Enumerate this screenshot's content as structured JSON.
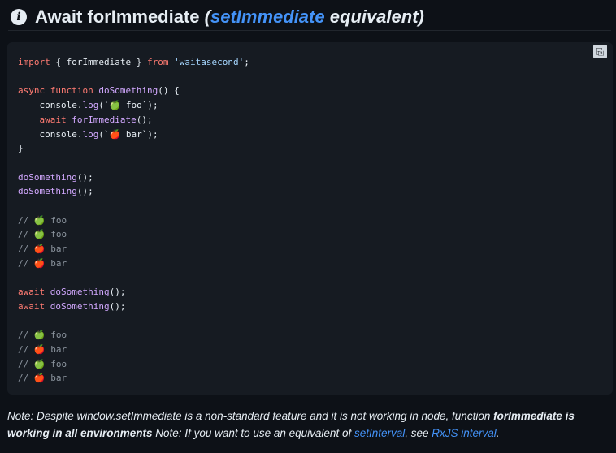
{
  "heading": {
    "anchor_glyph": "i",
    "title_main": "Await forImmediate ",
    "paren_open": "(",
    "link_text": "setImmediate",
    "paren_rest": " equivalent)"
  },
  "code": {
    "copy_icon": "copy-icon",
    "lines": {
      "l1": {
        "kw1": "import",
        "p1": " { forImmediate } ",
        "kw2": "from",
        "sp": " ",
        "str": "'waitasecond'",
        "end": ";"
      },
      "l3": {
        "kw1": "async",
        "sp1": " ",
        "kw2": "function",
        "sp2": " ",
        "fn": "doSomething",
        "end": "() {"
      },
      "l4": {
        "indent": "    console.",
        "fn": "log",
        "open": "(`",
        "icon": "🍏",
        "text": " foo`);"
      },
      "l5": {
        "indent": "    ",
        "kw": "await",
        "sp": " ",
        "fn": "forImmediate",
        "end": "();"
      },
      "l6": {
        "indent": "    console.",
        "fn": "log",
        "open": "(`",
        "icon": "🍎",
        "text": " bar`);"
      },
      "l7": {
        "text": "}"
      },
      "l9": {
        "fn": "doSomething",
        "end": "();"
      },
      "l10": {
        "fn": "doSomething",
        "end": "();"
      },
      "c1": {
        "slash": "// ",
        "icon": "🍏",
        "text": " foo"
      },
      "c2": {
        "slash": "// ",
        "icon": "🍏",
        "text": " foo"
      },
      "c3": {
        "slash": "// ",
        "icon": "🍎",
        "text": " bar"
      },
      "c4": {
        "slash": "// ",
        "icon": "🍎",
        "text": " bar"
      },
      "l17": {
        "kw": "await",
        "sp": " ",
        "fn": "doSomething",
        "end": "();"
      },
      "l18": {
        "kw": "await",
        "sp": " ",
        "fn": "doSomething",
        "end": "();"
      },
      "c5": {
        "slash": "// ",
        "icon": "🍏",
        "text": " foo"
      },
      "c6": {
        "slash": "// ",
        "icon": "🍎",
        "text": " bar"
      },
      "c7": {
        "slash": "// ",
        "icon": "🍏",
        "text": " foo"
      },
      "c8": {
        "slash": "// ",
        "icon": "🍎",
        "text": " bar"
      }
    }
  },
  "note": {
    "part1": "Note: Despite window.setImmediate is a non-standard feature and it is not working in node, function ",
    "bold": "forImmediate is working in all environments",
    "part2": " Note: If you want to use an equivalent of ",
    "link1": "setInterval",
    "part3": ", see ",
    "link2": "RxJS interval",
    "part4": "."
  },
  "colors": {
    "background": "#0d1117",
    "code_background": "#161b22",
    "link": "#4493f8",
    "keyword": "#ff7b72",
    "function": "#d2a8ff",
    "string": "#a5d6ff",
    "comment": "#8b949e"
  }
}
